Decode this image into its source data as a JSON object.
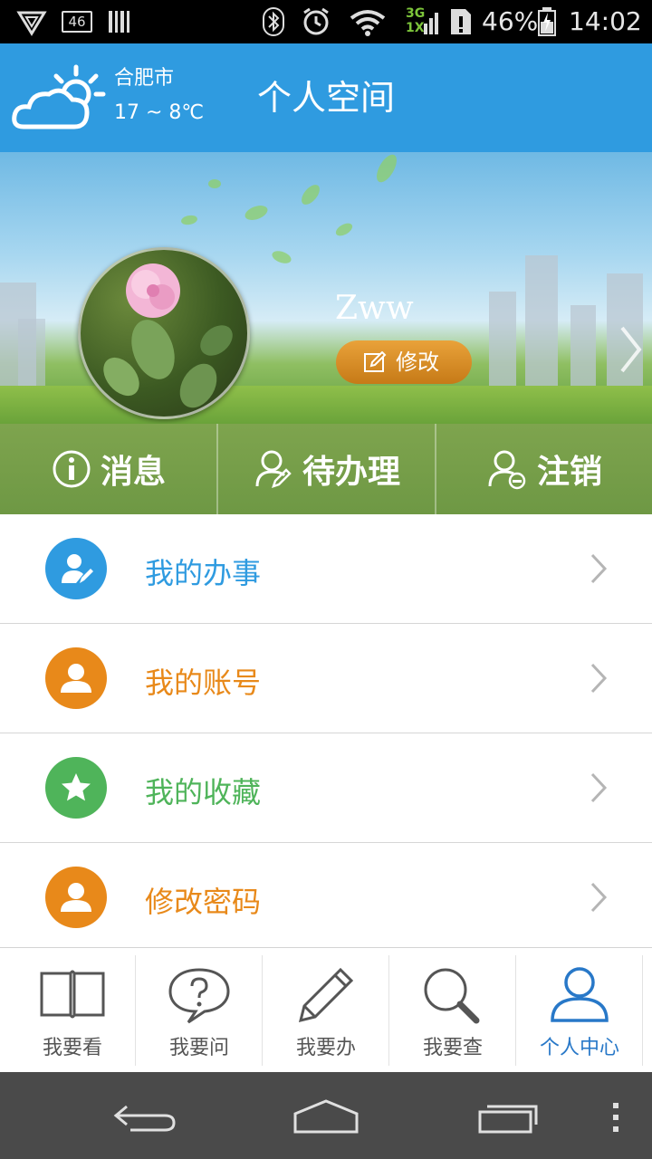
{
  "status_bar": {
    "signal_badge": "46",
    "battery": "46%",
    "time": "14:02",
    "net_top": "3G",
    "net_bottom": "1X"
  },
  "header": {
    "city": "合肥市",
    "temperature": "17 ~ 8℃",
    "title": "个人空间"
  },
  "profile": {
    "username": "Zww",
    "edit_label": "修改"
  },
  "actions": [
    {
      "label": "消息",
      "icon": "info-icon"
    },
    {
      "label": "待办理",
      "icon": "user-edit-icon"
    },
    {
      "label": "注销",
      "icon": "user-logout-icon"
    }
  ],
  "menu": [
    {
      "label": "我的办事",
      "icon": "user-pen-icon",
      "color": "#2f9be0"
    },
    {
      "label": "我的账号",
      "icon": "user-icon",
      "color": "#e8891a"
    },
    {
      "label": "我的收藏",
      "icon": "star-icon",
      "color": "#4fb45a"
    },
    {
      "label": "修改密码",
      "icon": "user-icon",
      "color": "#e8891a"
    }
  ],
  "tabs": [
    {
      "label": "我要看",
      "icon": "book-icon"
    },
    {
      "label": "我要问",
      "icon": "question-bubble-icon"
    },
    {
      "label": "我要办",
      "icon": "pencil-icon"
    },
    {
      "label": "我要查",
      "icon": "search-icon"
    },
    {
      "label": "个人中心",
      "icon": "person-icon",
      "active": true
    }
  ],
  "colors": {
    "header": "#2f9be0",
    "edit_button": "#d98a24",
    "tab_active": "#2878c8",
    "navbar": "#4a4a4a"
  }
}
